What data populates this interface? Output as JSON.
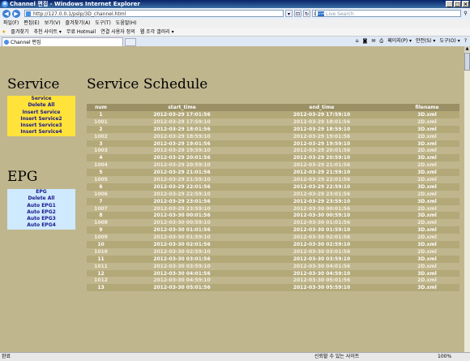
{
  "window": {
    "title": "Channel 편집 - Windows Internet Explorer",
    "controls": [
      "_",
      "□",
      "×"
    ]
  },
  "address": {
    "url": "http://127.0.0.1/pslp/3D_channel.html",
    "search_placeholder": "Live Search",
    "live_label": "Live"
  },
  "menubar": [
    "파일(F)",
    "편집(E)",
    "보기(V)",
    "즐겨찾기(A)",
    "도구(T)",
    "도움말(H)"
  ],
  "favorites": {
    "label": "즐겨찾기",
    "items": [
      "추천 사이트 ▾",
      "무료 Hotmail",
      "연결 사용자 정의",
      "웹 조각 갤러리 ▾"
    ]
  },
  "tab": {
    "label": "Channel 편집"
  },
  "commandbar": [
    "페이지(P) ▾",
    "안전(S) ▾",
    "도구(O) ▾"
  ],
  "sidebar": {
    "service_heading": "Service",
    "service_menu": [
      "Service",
      "Delete All",
      "Insert Service",
      "Insert Service2",
      "Insert Service3",
      "Insert Service4"
    ],
    "epg_heading": "EPG",
    "epg_menu": [
      "EPG",
      "Delete All",
      "Auto EPG1",
      "Auto EPG2",
      "Auto EPG3",
      "Auto EPG4"
    ]
  },
  "main": {
    "heading": "Service Schedule",
    "columns": [
      "num",
      "start_time",
      "end_time",
      "filename"
    ],
    "rows": [
      [
        "1",
        "2012-03-29 17:01:56",
        "2012-03-29 17:59:10",
        "3D.xml"
      ],
      [
        "1001",
        "2012-03-29 17:59:10",
        "2012-03-29 18:01:56",
        "2D.xml"
      ],
      [
        "2",
        "2012-03-29 18:01:56",
        "2012-03-29 18:59:10",
        "3D.xml"
      ],
      [
        "1002",
        "2012-03-29 18:59:10",
        "2012-03-29 19:01:56",
        "2D.xml"
      ],
      [
        "3",
        "2012-03-29 19:01:56",
        "2012-03-29 19:59:10",
        "3D.xml"
      ],
      [
        "1003",
        "2012-03-29 19:59:10",
        "2012-03-29 20:01:56",
        "2D.xml"
      ],
      [
        "4",
        "2012-03-29 20:01:56",
        "2012-03-29 20:59:10",
        "3D.xml"
      ],
      [
        "1004",
        "2012-03-29 20:59:10",
        "2012-03-29 21:01:56",
        "2D.xml"
      ],
      [
        "5",
        "2012-03-29 21:01:56",
        "2012-03-29 21:59:10",
        "3D.xml"
      ],
      [
        "1005",
        "2012-03-29 21:59:10",
        "2012-03-29 22:01:56",
        "2D.xml"
      ],
      [
        "6",
        "2012-03-29 22:01:56",
        "2012-03-29 22:59:10",
        "3D.xml"
      ],
      [
        "1006",
        "2012-03-29 22:59:10",
        "2012-03-29 23:01:56",
        "2D.xml"
      ],
      [
        "7",
        "2012-03-29 23:01:56",
        "2012-03-29 23:59:10",
        "3D.xml"
      ],
      [
        "1007",
        "2012-03-29 23:59:10",
        "2012-03-30 00:01:56",
        "2D.xml"
      ],
      [
        "8",
        "2012-03-30 00:01:56",
        "2012-03-30 00:59:10",
        "3D.xml"
      ],
      [
        "1008",
        "2012-03-30 00:59:10",
        "2012-03-30 01:01:56",
        "2D.xml"
      ],
      [
        "9",
        "2012-03-30 01:01:56",
        "2012-03-30 01:59:10",
        "3D.xml"
      ],
      [
        "1009",
        "2012-03-30 01:59:10",
        "2012-03-30 02:01:56",
        "2D.xml"
      ],
      [
        "10",
        "2012-03-30 02:01:56",
        "2012-03-30 02:59:10",
        "3D.xml"
      ],
      [
        "1010",
        "2012-03-30 02:59:10",
        "2012-03-30 03:01:56",
        "2D.xml"
      ],
      [
        "11",
        "2012-03-30 03:01:56",
        "2012-03-30 03:59:10",
        "3D.xml"
      ],
      [
        "1011",
        "2012-03-30 03:59:10",
        "2012-03-30 04:01:56",
        "2D.xml"
      ],
      [
        "12",
        "2012-03-30 04:01:56",
        "2012-03-30 04:59:10",
        "3D.xml"
      ],
      [
        "1012",
        "2012-03-30 04:59:10",
        "2012-03-30 05:01:56",
        "2D.xml"
      ],
      [
        "13",
        "2012-03-30 05:01:56",
        "2012-03-30 05:59:10",
        "3D.xml"
      ]
    ]
  },
  "status": {
    "left": "완료",
    "zone": "신뢰할 수 있는 사이트",
    "zoom": "100%"
  }
}
